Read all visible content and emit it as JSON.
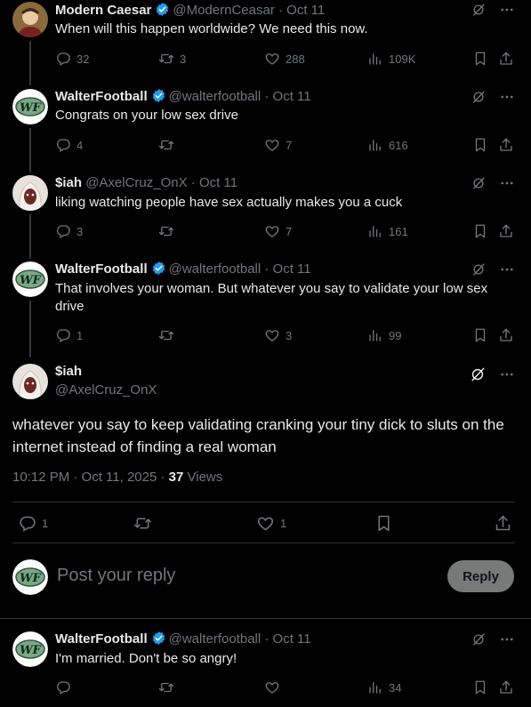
{
  "posts": [
    {
      "name": "Modern Caesar",
      "handle": "@ModernCeasar",
      "date": "· Oct 11",
      "text": "When will this happen worldwide? We need this now.",
      "replies": "32",
      "reposts": "3",
      "likes": "288",
      "views": "109K"
    },
    {
      "name": "WalterFootball",
      "handle": "@walterfootball",
      "date": "· Oct 11",
      "text": "Congrats on your low sex drive",
      "replies": "4",
      "reposts": "",
      "likes": "7",
      "views": "616"
    },
    {
      "name": "$iah",
      "handle": "@AxelCruz_OnX",
      "date": "· Oct 11",
      "text": "liking watching people have sex actually makes you a cuck",
      "replies": "3",
      "reposts": "",
      "likes": "7",
      "views": "161"
    },
    {
      "name": "WalterFootball",
      "handle": "@walterfootball",
      "date": "· Oct 11",
      "text": "That involves your woman. But whatever you say to validate your low sex drive",
      "replies": "1",
      "reposts": "",
      "likes": "3",
      "views": "99"
    }
  ],
  "focus": {
    "name": "$iah",
    "handle": "@AxelCruz_OnX",
    "text": "whatever you say to keep validating cranking your tiny dick to sluts on the internet instead of finding a real woman",
    "timestamp": "10:12 PM · Oct 11, 2025 · ",
    "views_count": "37",
    "views_label": " Views",
    "replies": "1",
    "likes": "1"
  },
  "composer": {
    "placeholder": "Post your reply",
    "button": "Reply"
  },
  "last_reply": {
    "name": "WalterFootball",
    "handle": "@walterfootball",
    "date": "· Oct 11",
    "text": "I'm married. Don't be so angry!",
    "views": "34"
  },
  "colors": {
    "accent": "#1d9bf0",
    "muted": "#71767b",
    "background": "#000000"
  },
  "icons": [
    "verified-badge-icon",
    "grok-icon",
    "more-icon",
    "reply-icon",
    "repost-icon",
    "like-icon",
    "views-icon",
    "bookmark-icon",
    "share-icon"
  ]
}
